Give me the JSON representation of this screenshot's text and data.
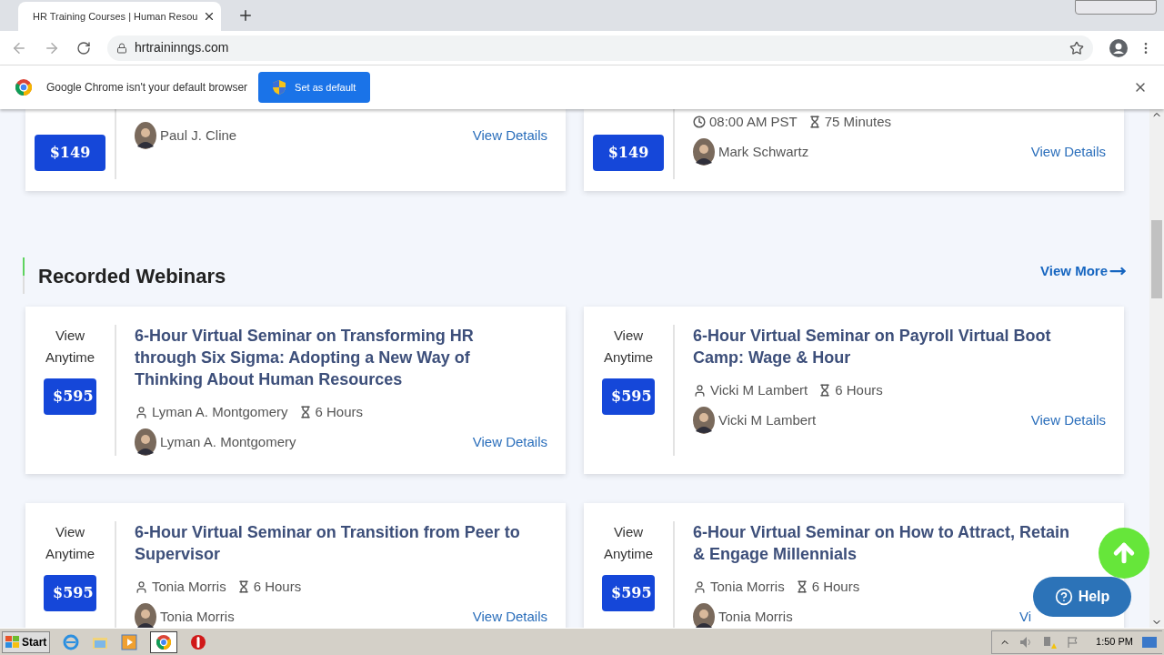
{
  "browser": {
    "tab_title": "HR Training Courses | Human Resou",
    "url": "hrtraininngs.com"
  },
  "infobar": {
    "message": "Google Chrome isn't your default browser",
    "button": "Set as default"
  },
  "upcoming_cards": [
    {
      "price": "$149",
      "speaker": "Paul J. Cline",
      "link": "View Details"
    },
    {
      "price": "$149",
      "time": "08:00 AM PST",
      "duration": "75 Minutes",
      "speaker": "Mark Schwartz",
      "link": "View Details"
    }
  ],
  "section": {
    "title": "Recorded Webinars",
    "view_more": "View More"
  },
  "recorded_cards": [
    {
      "availability": "View Anytime",
      "price": "$595",
      "title": "6-Hour Virtual Seminar on Transforming HR through Six Sigma: Adopting a New Way of Thinking About Human Resources",
      "instructor": "Lyman A. Montgomery",
      "duration": "6 Hours",
      "speaker": "Lyman A. Montgomery",
      "link": "View Details"
    },
    {
      "availability": "View Anytime",
      "price": "$595",
      "title": "6-Hour Virtual Seminar on Payroll Virtual Boot Camp: Wage & Hour",
      "instructor": "Vicki M Lambert",
      "duration": "6 Hours",
      "speaker": "Vicki M Lambert",
      "link": "View Details"
    },
    {
      "availability": "View Anytime",
      "price": "$595",
      "title": "6-Hour Virtual Seminar on Transition from Peer to Supervisor",
      "instructor": "Tonia Morris",
      "duration": "6 Hours",
      "speaker": "Tonia Morris",
      "link": "View Details"
    },
    {
      "availability": "View Anytime",
      "price": "$595",
      "title": "6-Hour Virtual Seminar on How to Attract, Retain & Engage Millennials",
      "instructor": "Tonia Morris",
      "duration": "6 Hours",
      "speaker": "Tonia Morris",
      "link": "Vi"
    }
  ],
  "help_button": "Help",
  "taskbar": {
    "start": "Start",
    "clock": "1:50 PM"
  }
}
